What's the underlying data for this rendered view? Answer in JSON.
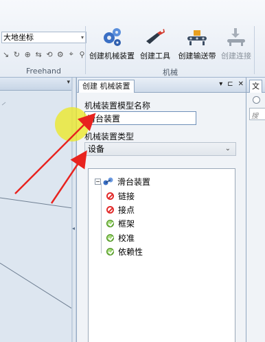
{
  "ribbon": {
    "coordinate_system": "大地坐标",
    "freehand_group": "Freehand",
    "mechanism_group": "机械",
    "buttons": {
      "create_mechanism": "创建机械装置",
      "create_tool": "创建工具",
      "create_conveyor": "创建输送带",
      "create_connection": "创建连接"
    }
  },
  "panel": {
    "tab_title": "创建 机械装置",
    "model_name_label": "机械装置模型名称",
    "model_name_value": "滑台装置",
    "type_label": "机械装置类型",
    "type_value": "设备",
    "tree": {
      "root": "滑台装置",
      "items": [
        {
          "label": "链接",
          "status": "error"
        },
        {
          "label": "接点",
          "status": "error"
        },
        {
          "label": "框架",
          "status": "ok"
        },
        {
          "label": "校准",
          "status": "ok"
        },
        {
          "label": "依赖性",
          "status": "ok"
        }
      ]
    }
  },
  "right_panel": {
    "tab_title": "文",
    "search_placeholder": "搜"
  },
  "colors": {
    "annotation_arrow": "#e8231f",
    "cursor_highlight": "#ece828",
    "error_icon": "#e22b2b",
    "ok_icon": "#5fae2c"
  }
}
